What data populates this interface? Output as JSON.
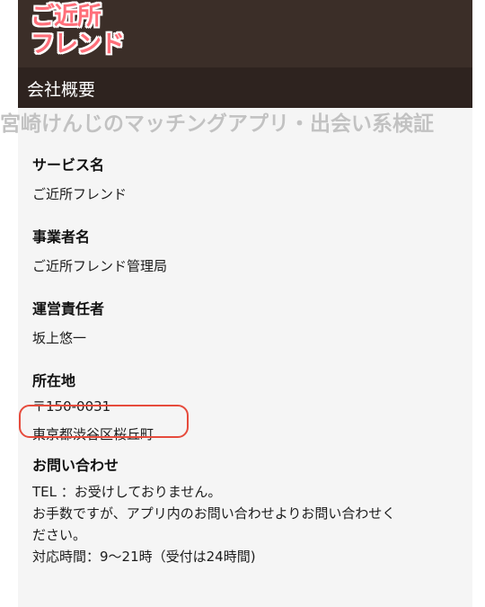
{
  "app": {
    "logo_line1": "ご近所",
    "logo_line2": "フレンド",
    "page_title": "会社概要",
    "watermark": "宮崎けんじのマッチングアプリ・出会い系検証"
  },
  "sections": {
    "service": {
      "heading": "サービス名",
      "value": "ご近所フレンド"
    },
    "operator": {
      "heading": "事業者名",
      "value": "ご近所フレンド管理局"
    },
    "manager": {
      "heading": "運営責任者",
      "value": "坂上悠一"
    },
    "address": {
      "heading": "所在地",
      "postal": "〒150-0031",
      "line": "東京都渋谷区桜丘町"
    },
    "contact": {
      "heading": "お問い合わせ",
      "tel": "TEL ：お受けしておりません。",
      "note1": "お手数ですが、アプリ内のお問い合わせよりお問い合わせく",
      "note2": "ださい。",
      "hours": "対応時間：9〜21時（受付は24時間)"
    }
  },
  "colors": {
    "appbar": "#3b2e28",
    "subbar": "#2e231f",
    "logo": "#ff6f7a",
    "highlight": "#e64b3c"
  }
}
